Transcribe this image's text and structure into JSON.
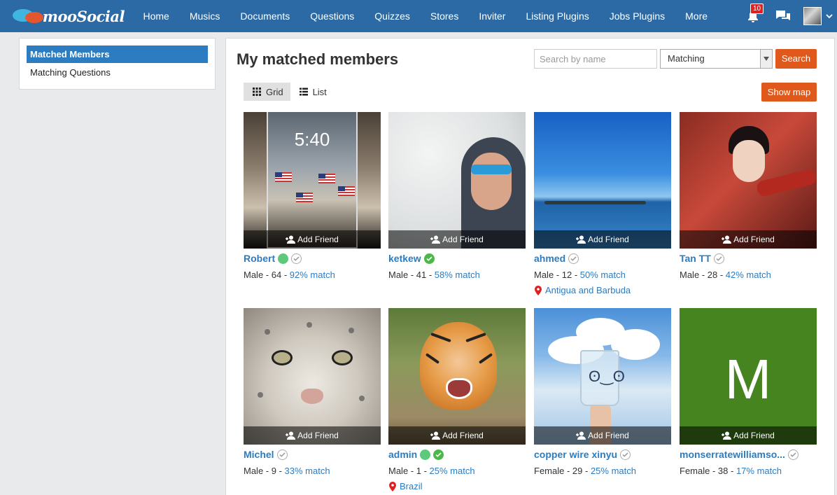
{
  "nav": {
    "logo_text": "mooSocial",
    "items": [
      "Home",
      "Musics",
      "Documents",
      "Questions",
      "Quizzes",
      "Stores",
      "Inviter",
      "Listing Plugins",
      "Jobs Plugins",
      "More"
    ],
    "notification_count": "10"
  },
  "sidebar": {
    "items": [
      {
        "label": "Matched Members",
        "active": true
      },
      {
        "label": "Matching Questions",
        "active": false
      }
    ]
  },
  "main": {
    "title": "My matched members",
    "search_placeholder": "Search by name",
    "filter_value": "Matching",
    "search_button": "Search",
    "show_map_button": "Show map",
    "view_grid_label": "Grid",
    "view_list_label": "List",
    "add_friend_label": "Add Friend"
  },
  "members": [
    {
      "name": "Robert",
      "gender": "Male",
      "age": "64",
      "match": "92% match",
      "online": true,
      "verified": false,
      "location": ""
    },
    {
      "name": "ketkew",
      "gender": "Male",
      "age": "41",
      "match": "58% match",
      "online": false,
      "verified": true,
      "location": ""
    },
    {
      "name": "ahmed",
      "gender": "Male",
      "age": "12",
      "match": "50% match",
      "online": false,
      "verified": false,
      "location": "Antigua and Barbuda"
    },
    {
      "name": "Tan TT",
      "gender": "Male",
      "age": "28",
      "match": "42% match",
      "online": false,
      "verified": false,
      "location": ""
    },
    {
      "name": "Michel",
      "gender": "Male",
      "age": "9",
      "match": "33% match",
      "online": false,
      "verified": false,
      "location": ""
    },
    {
      "name": "admin",
      "gender": "Male",
      "age": "1",
      "match": "25% match",
      "online": true,
      "verified": true,
      "location": "Brazil"
    },
    {
      "name": "copper wire xinyu",
      "gender": "Female",
      "age": "29",
      "match": "25% match",
      "online": false,
      "verified": false,
      "location": ""
    },
    {
      "name": "monserratewilliamso...",
      "gender": "Female",
      "age": "38",
      "match": "17% match",
      "online": false,
      "verified": false,
      "location": "",
      "avatar_letter": "M"
    }
  ],
  "photo_screen_text": {
    "time": "5:40"
  },
  "colors": {
    "nav_bg": "#2b6aa5",
    "accent_blue": "#2b7cc0",
    "orange": "#e0591c",
    "online": "#5cc97b",
    "verified": "#4cb848"
  }
}
